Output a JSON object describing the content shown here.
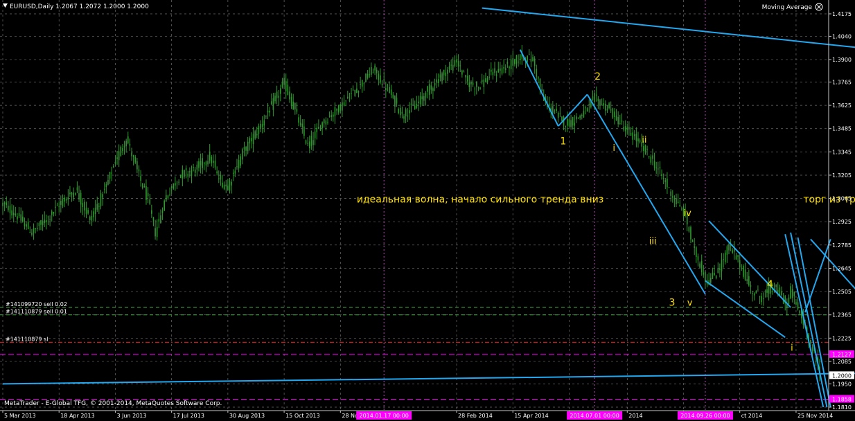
{
  "header": {
    "symbol_line": "EURUSD,Daily  1.2067 1.2072 1.2000 1.2000",
    "indicator": "Moving Average",
    "indicator_icon": "close-circle-icon"
  },
  "footer": {
    "copyright": "MetaTrader - E-Global TFG, © 2001-2014, MetaQuotes Software Corp."
  },
  "colors": {
    "background": "#000000",
    "candle": "#2e9a2e",
    "grid": "#c8c8c8",
    "trendline": "#22a8f0",
    "annotation": "#ffe000",
    "separator": "#c040c0",
    "orders": "#4ab04a",
    "stop": "#e02020",
    "price_tag": "#ff00ff"
  },
  "orders": [
    {
      "label": "#141099720 sell 0.02",
      "price": 1.241,
      "style": "dashed-green"
    },
    {
      "label": "#141110879 sell 0.01",
      "price": 1.2365,
      "style": "dashed-green"
    },
    {
      "label": "#141110879 sl",
      "price": 1.22,
      "style": "dashdot-red"
    }
  ],
  "price_tags": [
    {
      "text": "1.2127",
      "price": 1.2127,
      "kind": "magenta"
    },
    {
      "text": "1.2000",
      "price": 1.2,
      "kind": "white"
    },
    {
      "text": "1.1858",
      "price": 1.1858,
      "kind": "magenta"
    }
  ],
  "chart_data": {
    "type": "candlestick",
    "y_axis": {
      "side": "right",
      "ticks": [
        "1.4175",
        "1.4040",
        "1.3900",
        "1.3765",
        "1.3625",
        "1.3485",
        "1.3345",
        "1.3205",
        "1.3065",
        "1.2925",
        "1.2785",
        "1.2645",
        "1.2505",
        "1.2365",
        "1.2225",
        "1.2085",
        "1.1950",
        "1.1810"
      ],
      "ylim": [
        1.181,
        1.4175
      ]
    },
    "x_axis": {
      "tick_labels": [
        "5 Mar 2013",
        "18 Apr 2013",
        "3 Jun 2013",
        "17 Jul 2013",
        "30 Aug 2013",
        "15 Oct 2013",
        "28 Nov",
        "28 Feb 2014",
        "15 Apr 2014",
        "2",
        "2014",
        "2",
        "ct 2014",
        "25 Nov 2014"
      ],
      "tick_index": [
        0,
        31,
        62,
        93,
        124,
        155,
        186,
        250,
        281,
        312,
        344,
        375,
        406,
        437
      ],
      "highlighted": [
        {
          "text": "2014.01.17 00:00",
          "index": 210
        },
        {
          "text": "2014.07.01 00:00",
          "index": 326
        },
        {
          "text": "2014.09.26 00:00",
          "index": 387
        }
      ]
    },
    "series_key_points": [
      [
        0,
        1.303
      ],
      [
        8,
        1.296
      ],
      [
        16,
        1.286
      ],
      [
        24,
        1.294
      ],
      [
        32,
        1.304
      ],
      [
        40,
        1.312
      ],
      [
        48,
        1.294
      ],
      [
        56,
        1.311
      ],
      [
        62,
        1.329
      ],
      [
        68,
        1.343
      ],
      [
        74,
        1.323
      ],
      [
        80,
        1.305
      ],
      [
        84,
        1.286
      ],
      [
        90,
        1.308
      ],
      [
        98,
        1.321
      ],
      [
        106,
        1.324
      ],
      [
        114,
        1.332
      ],
      [
        120,
        1.316
      ],
      [
        124,
        1.314
      ],
      [
        132,
        1.334
      ],
      [
        140,
        1.347
      ],
      [
        148,
        1.362
      ],
      [
        155,
        1.376
      ],
      [
        162,
        1.356
      ],
      [
        168,
        1.338
      ],
      [
        176,
        1.352
      ],
      [
        186,
        1.362
      ],
      [
        196,
        1.374
      ],
      [
        204,
        1.384
      ],
      [
        212,
        1.372
      ],
      [
        220,
        1.357
      ],
      [
        228,
        1.363
      ],
      [
        236,
        1.374
      ],
      [
        244,
        1.383
      ],
      [
        250,
        1.389
      ],
      [
        256,
        1.376
      ],
      [
        262,
        1.374
      ],
      [
        270,
        1.382
      ],
      [
        278,
        1.386
      ],
      [
        286,
        1.392
      ],
      [
        292,
        1.39
      ],
      [
        298,
        1.365
      ],
      [
        304,
        1.358
      ],
      [
        310,
        1.352
      ],
      [
        314,
        1.353
      ],
      [
        322,
        1.36
      ],
      [
        326,
        1.367
      ],
      [
        334,
        1.36
      ],
      [
        344,
        1.347
      ],
      [
        350,
        1.341
      ],
      [
        358,
        1.329
      ],
      [
        364,
        1.318
      ],
      [
        370,
        1.306
      ],
      [
        376,
        1.296
      ],
      [
        380,
        1.278
      ],
      [
        388,
        1.256
      ],
      [
        394,
        1.263
      ],
      [
        400,
        1.278
      ],
      [
        406,
        1.267
      ],
      [
        412,
        1.252
      ],
      [
        418,
        1.247
      ],
      [
        424,
        1.254
      ],
      [
        428,
        1.249
      ],
      [
        432,
        1.242
      ],
      [
        434,
        1.251
      ],
      [
        438,
        1.24
      ],
      [
        442,
        1.229
      ],
      [
        446,
        1.215
      ],
      [
        449,
        1.2067
      ],
      [
        450,
        1.2
      ]
    ]
  },
  "annotations": [
    {
      "id": "wave-1",
      "text": "1",
      "index": 307,
      "price": 1.339,
      "size": 14
    },
    {
      "id": "wave-2",
      "text": "2",
      "index": 326,
      "price": 1.378,
      "size": 14
    },
    {
      "id": "wave-3-label",
      "text": "3",
      "index": 367,
      "price": 1.242,
      "size": 14
    },
    {
      "id": "wave-4",
      "text": "4",
      "index": 421,
      "price": 1.253,
      "size": 14
    },
    {
      "id": "sub-i",
      "text": "i",
      "index": 336,
      "price": 1.335,
      "size": 13
    },
    {
      "id": "sub-ii",
      "text": "ii",
      "index": 352,
      "price": 1.34,
      "size": 13
    },
    {
      "id": "sub-iii",
      "text": "iii",
      "index": 356,
      "price": 1.279,
      "size": 13
    },
    {
      "id": "sub-iv",
      "text": "iv",
      "index": 375,
      "price": 1.296,
      "size": 13
    },
    {
      "id": "sub-v",
      "text": "v",
      "index": 377,
      "price": 1.242,
      "size": 13
    },
    {
      "id": "sub-i-bottom",
      "text": "i",
      "index": 434,
      "price": 1.215,
      "size": 13
    },
    {
      "id": "caption-wave",
      "text": "идеальная волна, начало сильного тренда вниз",
      "index": 195,
      "price": 1.304,
      "size": 14
    },
    {
      "id": "caption-triangle",
      "text": "торг из треуголника (низ)",
      "index": 441,
      "price": 1.304,
      "size": 14
    }
  ],
  "trendlines": [
    {
      "from": [
        264,
        1.421
      ],
      "to": [
        560,
        1.387
      ]
    },
    {
      "from": [
        285,
        1.396
      ],
      "to": [
        306,
        1.35
      ]
    },
    {
      "from": [
        306,
        1.35
      ],
      "to": [
        322,
        1.369
      ]
    },
    {
      "from": [
        322,
        1.369
      ],
      "to": [
        387,
        1.249
      ]
    },
    {
      "from": [
        387,
        1.257
      ],
      "to": [
        431,
        1.223
      ]
    },
    {
      "from": [
        389,
        1.293
      ],
      "to": [
        434,
        1.241
      ]
    },
    {
      "from": [
        434,
        1.286
      ],
      "to": [
        454,
        1.181
      ]
    },
    {
      "from": [
        431,
        1.285
      ],
      "to": [
        452,
        1.181
      ]
    },
    {
      "from": [
        438,
        1.283
      ],
      "to": [
        456,
        1.181
      ]
    },
    {
      "from": [
        442,
        1.238
      ],
      "to": [
        456,
        1.282
      ]
    },
    {
      "from": [
        445,
        1.282
      ],
      "to": [
        512,
        1.201
      ]
    },
    {
      "from": [
        476,
        1.241
      ],
      "to": [
        525,
        1.181
      ]
    },
    {
      "from": [
        0,
        1.195
      ],
      "to": [
        560,
        1.2025
      ]
    }
  ]
}
